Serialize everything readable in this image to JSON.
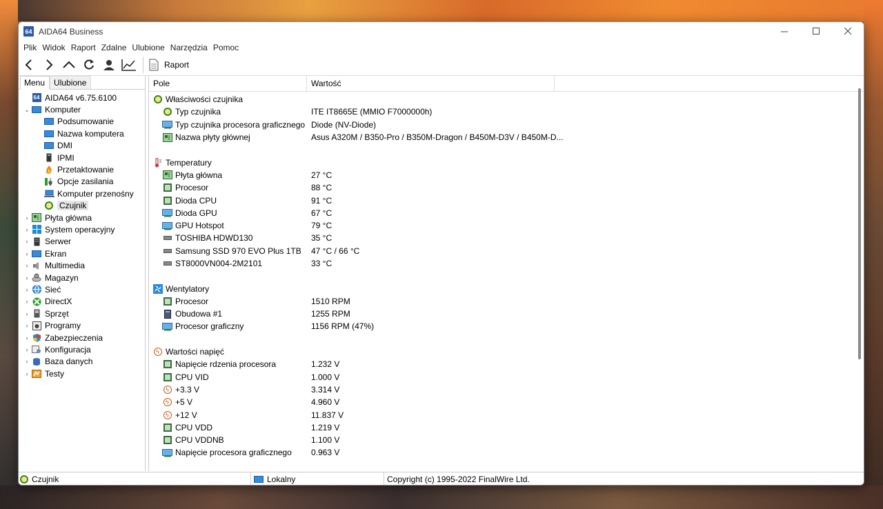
{
  "window": {
    "title": "AIDA64 Business",
    "logo": "64"
  },
  "menu": [
    "Plik",
    "Widok",
    "Raport",
    "Zdalne",
    "Ulubione",
    "Narzędzia",
    "Pomoc"
  ],
  "toolbar": {
    "report_label": "Raport"
  },
  "tabs": [
    "Menu",
    "Ulubione"
  ],
  "tree": [
    {
      "label": "AIDA64 v6.75.6100",
      "indent": 0,
      "arrow": "",
      "icon": "aida64-icon"
    },
    {
      "label": "Komputer",
      "indent": 0,
      "arrow": "⌄",
      "icon": "computer-icon"
    },
    {
      "label": "Podsumowanie",
      "indent": 1,
      "arrow": "",
      "icon": "monitor-icon"
    },
    {
      "label": "Nazwa komputera",
      "indent": 1,
      "arrow": "",
      "icon": "monitor-icon"
    },
    {
      "label": "DMI",
      "indent": 1,
      "arrow": "",
      "icon": "monitor-icon"
    },
    {
      "label": "IPMI",
      "indent": 1,
      "arrow": "",
      "icon": "ipmi-icon"
    },
    {
      "label": "Przetaktowanie",
      "indent": 1,
      "arrow": "",
      "icon": "flame-icon"
    },
    {
      "label": "Opcje zasilania",
      "indent": 1,
      "arrow": "",
      "icon": "power-icon"
    },
    {
      "label": "Komputer przenośny",
      "indent": 1,
      "arrow": "",
      "icon": "laptop-icon"
    },
    {
      "label": "Czujnik",
      "indent": 1,
      "arrow": "",
      "icon": "sensor-icon",
      "selected": true
    },
    {
      "label": "Płyta główna",
      "indent": 0,
      "arrow": "›",
      "icon": "motherboard-icon"
    },
    {
      "label": "System operacyjny",
      "indent": 0,
      "arrow": "›",
      "icon": "windows-icon"
    },
    {
      "label": "Serwer",
      "indent": 0,
      "arrow": "›",
      "icon": "server-icon"
    },
    {
      "label": "Ekran",
      "indent": 0,
      "arrow": "›",
      "icon": "display-icon"
    },
    {
      "label": "Multimedia",
      "indent": 0,
      "arrow": "›",
      "icon": "speaker-icon"
    },
    {
      "label": "Magazyn",
      "indent": 0,
      "arrow": "›",
      "icon": "storage-icon"
    },
    {
      "label": "Sieć",
      "indent": 0,
      "arrow": "›",
      "icon": "network-icon"
    },
    {
      "label": "DirectX",
      "indent": 0,
      "arrow": "›",
      "icon": "directx-icon"
    },
    {
      "label": "Sprzęt",
      "indent": 0,
      "arrow": "›",
      "icon": "device-icon"
    },
    {
      "label": "Programy",
      "indent": 0,
      "arrow": "›",
      "icon": "programs-icon"
    },
    {
      "label": "Zabezpieczenia",
      "indent": 0,
      "arrow": "›",
      "icon": "shield-icon"
    },
    {
      "label": "Konfiguracja",
      "indent": 0,
      "arrow": "›",
      "icon": "config-icon"
    },
    {
      "label": "Baza danych",
      "indent": 0,
      "arrow": "›",
      "icon": "database-icon"
    },
    {
      "label": "Testy",
      "indent": 0,
      "arrow": "›",
      "icon": "benchmark-icon"
    }
  ],
  "columns": {
    "field": "Pole",
    "value": "Wartość"
  },
  "sections": [
    {
      "title": "Właściwości czujnika",
      "icon": "sensor-icon",
      "rows": [
        {
          "field": "Typ czujnika",
          "value": "ITE IT8665E  (MMIO F7000000h)",
          "icon": "sensor-icon"
        },
        {
          "field": "Typ czujnika procesora graficznego",
          "value": "Diode  (NV-Diode)",
          "icon": "gpu-icon"
        },
        {
          "field": "Nazwa płyty głównej",
          "value": "Asus A320M / B350-Pro / B350M-Dragon / B450M-D3V / B450M-D...",
          "icon": "motherboard-icon"
        }
      ]
    },
    {
      "title": "Temperatury",
      "icon": "thermometer-icon",
      "rows": [
        {
          "field": "Płyta główna",
          "value": "27 °C",
          "icon": "motherboard-icon"
        },
        {
          "field": "Procesor",
          "value": "88 °C",
          "icon": "cpu-icon"
        },
        {
          "field": "Dioda CPU",
          "value": "91 °C",
          "icon": "cpu-icon"
        },
        {
          "field": "Dioda GPU",
          "value": "67 °C",
          "icon": "gpu-icon"
        },
        {
          "field": "GPU Hotspot",
          "value": "79 °C",
          "icon": "gpu-icon"
        },
        {
          "field": "TOSHIBA HDWD130",
          "value": "35 °C",
          "icon": "hdd-icon"
        },
        {
          "field": "Samsung SSD 970 EVO Plus 1TB",
          "value": "47 °C / 66 °C",
          "icon": "hdd-icon"
        },
        {
          "field": "ST8000VN004-2M2101",
          "value": "33 °C",
          "icon": "hdd-icon"
        }
      ]
    },
    {
      "title": "Wentylatory",
      "icon": "fan-icon",
      "rows": [
        {
          "field": "Procesor",
          "value": "1510 RPM",
          "icon": "cpu-icon"
        },
        {
          "field": "Obudowa #1",
          "value": "1255 RPM",
          "icon": "case-icon"
        },
        {
          "field": "Procesor graficzny",
          "value": "1156 RPM  (47%)",
          "icon": "gpu-icon"
        }
      ]
    },
    {
      "title": "Wartości napięć",
      "icon": "voltage-icon",
      "rows": [
        {
          "field": "Napięcie rdzenia procesora",
          "value": "1.232 V",
          "icon": "cpu-icon"
        },
        {
          "field": "CPU VID",
          "value": "1.000 V",
          "icon": "cpu-icon"
        },
        {
          "field": "+3.3 V",
          "value": "3.314 V",
          "icon": "voltage-icon"
        },
        {
          "field": "+5 V",
          "value": "4.960 V",
          "icon": "voltage-icon"
        },
        {
          "field": "+12 V",
          "value": "11.837 V",
          "icon": "voltage-icon"
        },
        {
          "field": "CPU VDD",
          "value": "1.219 V",
          "icon": "cpu-icon"
        },
        {
          "field": "CPU VDDNB",
          "value": "1.100 V",
          "icon": "cpu-icon"
        },
        {
          "field": "Napięcie procesora graficznego",
          "value": "0.963 V",
          "icon": "gpu-icon"
        }
      ]
    }
  ],
  "status": {
    "left": "Czujnik",
    "middle": "Lokalny",
    "right": "Copyright (c) 1995-2022 FinalWire Ltd."
  }
}
